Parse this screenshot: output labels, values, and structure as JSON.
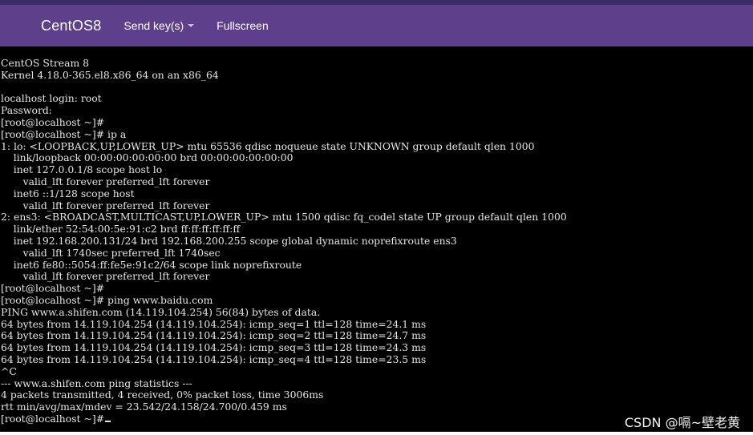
{
  "navbar": {
    "brand": "CentOS8",
    "send_keys_label": "Send key(s)",
    "fullscreen_label": "Fullscreen"
  },
  "terminal": {
    "lines": [
      "CentOS Stream 8",
      "Kernel 4.18.0-365.el8.x86_64 on an x86_64",
      "",
      "localhost login: root",
      "Password:",
      "[root@localhost ~]#",
      "[root@localhost ~]# ip a",
      "1: lo: <LOOPBACK,UP,LOWER_UP> mtu 65536 qdisc noqueue state UNKNOWN group default qlen 1000",
      "    link/loopback 00:00:00:00:00:00 brd 00:00:00:00:00:00",
      "    inet 127.0.0.1/8 scope host lo",
      "       valid_lft forever preferred_lft forever",
      "    inet6 ::1/128 scope host",
      "       valid_lft forever preferred_lft forever",
      "2: ens3: <BROADCAST,MULTICAST,UP,LOWER_UP> mtu 1500 qdisc fq_codel state UP group default qlen 1000",
      "    link/ether 52:54:00:5e:91:c2 brd ff:ff:ff:ff:ff:ff",
      "    inet 192.168.200.131/24 brd 192.168.200.255 scope global dynamic noprefixroute ens3",
      "       valid_lft 1740sec preferred_lft 1740sec",
      "    inet6 fe80::5054:ff:fe5e:91c2/64 scope link noprefixroute",
      "       valid_lft forever preferred_lft forever",
      "[root@localhost ~]#",
      "[root@localhost ~]# ping www.baidu.com",
      "PING www.a.shifen.com (14.119.104.254) 56(84) bytes of data.",
      "64 bytes from 14.119.104.254 (14.119.104.254): icmp_seq=1 ttl=128 time=24.1 ms",
      "64 bytes from 14.119.104.254 (14.119.104.254): icmp_seq=2 ttl=128 time=24.7 ms",
      "64 bytes from 14.119.104.254 (14.119.104.254): icmp_seq=3 ttl=128 time=24.3 ms",
      "64 bytes from 14.119.104.254 (14.119.104.254): icmp_seq=4 ttl=128 time=23.5 ms",
      "^C",
      "--- www.a.shifen.com ping statistics ---",
      "4 packets transmitted, 4 received, 0% packet loss, time 3006ms",
      "rtt min/avg/max/mdev = 23.542/24.158/24.700/0.459 ms",
      "[root@localhost ~]#"
    ]
  },
  "watermark": "CSDN @嗝~壁老黄",
  "colors": {
    "navbar_bg": "#5d3f8c",
    "terminal_bg": "#000000",
    "terminal_fg": "#e6e6e6"
  },
  "icons": {
    "dropdown": "caret-down-icon"
  }
}
